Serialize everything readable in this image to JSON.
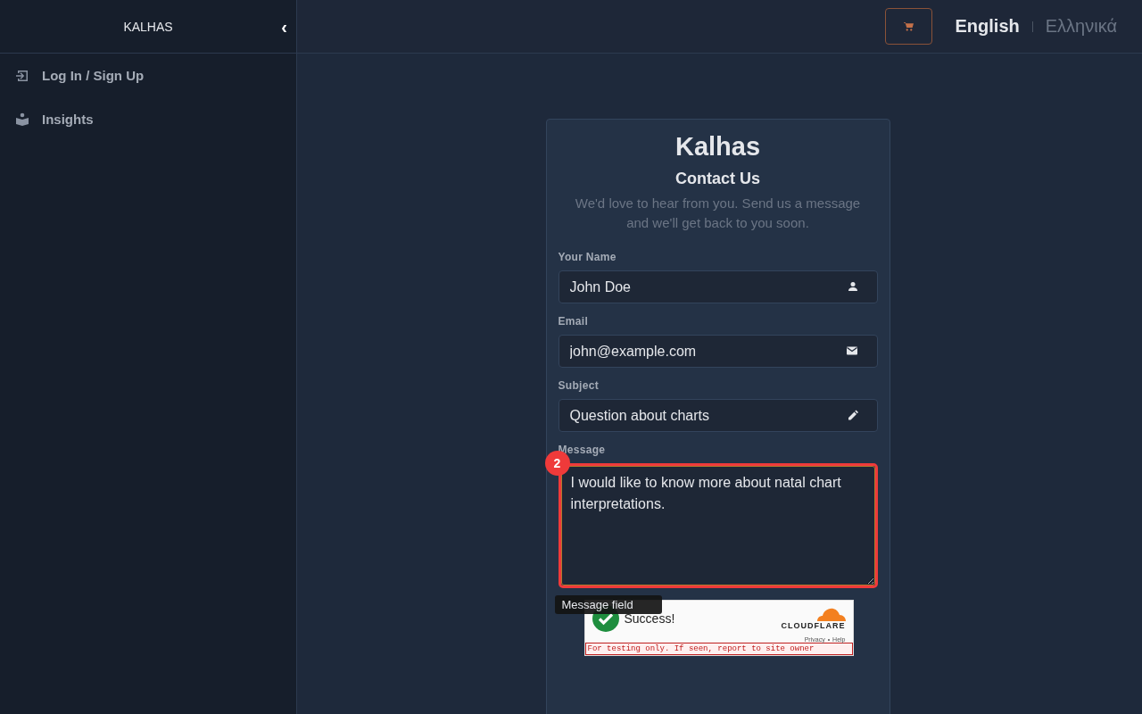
{
  "sidebar": {
    "brand": "KALHAS",
    "collapse_icon": "‹",
    "items": [
      {
        "label": "Log In / Sign Up"
      },
      {
        "label": "Insights"
      }
    ]
  },
  "header": {
    "languages": [
      {
        "label": "English",
        "selected": true
      },
      {
        "label": "Ελληνικά",
        "selected": false
      }
    ]
  },
  "form": {
    "title": "Kalhas",
    "heading": "Contact Us",
    "intro": "We'd love to hear from you. Send us a message and we'll get back to you soon.",
    "fields": [
      {
        "kind": "input",
        "label": "Your Name",
        "value": "John Doe"
      },
      {
        "kind": "input",
        "label": "Email",
        "value": "john@example.com"
      },
      {
        "kind": "input",
        "label": "Subject",
        "value": "Question about charts"
      },
      {
        "kind": "textarea",
        "label": "Message",
        "value": "I would like to know more about natal chart interpretations.",
        "highlighted": true,
        "badge": "2",
        "tooltip": "Message field"
      }
    ],
    "captcha": {
      "status": "Success!",
      "brand": "CLOUDFLARE",
      "privacy": "Privacy",
      "separator": "•",
      "help": "Help",
      "warning": "For testing only. If seen, report to site owner"
    }
  }
}
